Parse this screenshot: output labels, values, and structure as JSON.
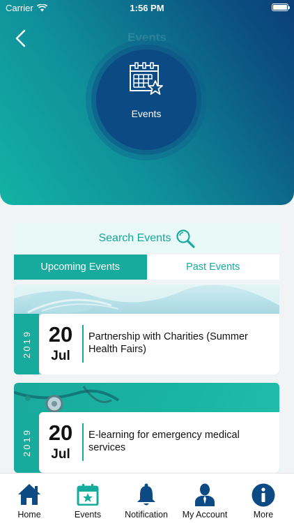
{
  "status_bar": {
    "carrier": "Carrier",
    "time": "1:56 PM"
  },
  "header": {
    "title": "Events",
    "circle_label": "Events"
  },
  "search": {
    "label": "Search Events"
  },
  "tabs": [
    {
      "label": "Upcoming Events",
      "active": true
    },
    {
      "label": "Past Events",
      "active": false
    }
  ],
  "events": [
    {
      "year": "2019",
      "day": "20",
      "month": "Jul",
      "title": "Partnership with Charities (Summer Health Fairs)"
    },
    {
      "year": "2019",
      "day": "20",
      "month": "Jul",
      "title": "E-learning for emergency medical services"
    }
  ],
  "nav": [
    {
      "label": "Home",
      "icon": "home-icon"
    },
    {
      "label": "Events",
      "icon": "calendar-star-icon"
    },
    {
      "label": "Notification",
      "icon": "bell-icon"
    },
    {
      "label": "My Account",
      "icon": "user-icon"
    },
    {
      "label": "More",
      "icon": "info-icon"
    }
  ],
  "colors": {
    "accent": "#17ab9e",
    "navy": "#0b4a82",
    "nav_icon": "#0b4a82"
  }
}
